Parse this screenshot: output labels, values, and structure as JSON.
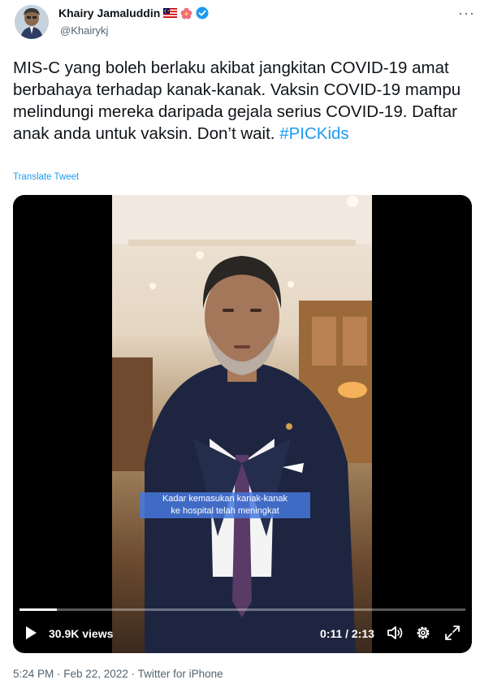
{
  "author": {
    "name": "Khairy Jamaluddin",
    "handle": "@Khairykj",
    "icons": [
      "malaysia-flag-icon",
      "hibiscus-icon",
      "verified-badge-icon"
    ]
  },
  "tweet": {
    "text": "MIS-C yang boleh berlaku akibat jangkitan COVID-19 amat berbahaya terhadap kanak-kanak. Vaksin COVID-19 mampu melindungi mereka daripada gejala serius COVID-19. Daftar anak anda untuk vaksin. Don’t wait. ",
    "hashtag": "#PICKids",
    "translate_label": "Translate Tweet"
  },
  "video": {
    "subtitle_line1": "Kadar kemasukan kanak-kanak",
    "subtitle_line2": "ke hospital telah meningkat",
    "views": "30.9K views",
    "time": "0:11 / 2:13",
    "progress": 0.083,
    "controls": [
      "play-icon",
      "volume-icon",
      "settings-gear-icon",
      "fullscreen-icon"
    ]
  },
  "meta": {
    "text": "5:24 PM · Feb 22, 2022 · Twitter for iPhone"
  },
  "colors": {
    "link": "#1d9bf0",
    "secondary_text": "#536471",
    "subtitle_bg": "#4678dc"
  }
}
